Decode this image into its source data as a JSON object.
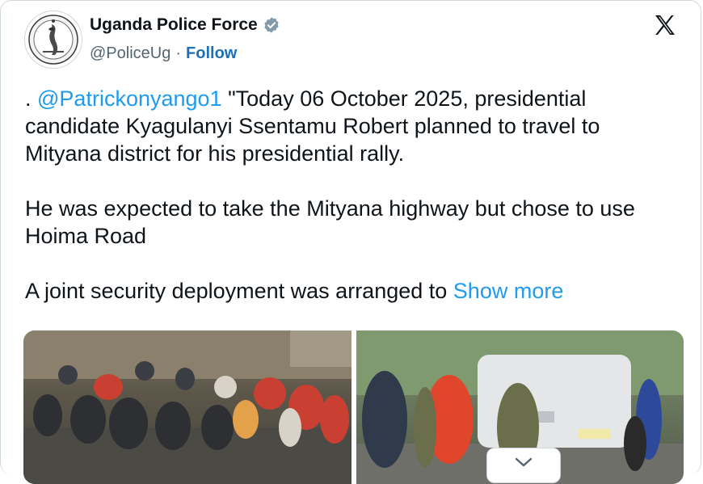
{
  "account": {
    "display_name": "Uganda Police Force",
    "handle": "@PoliceUg",
    "separator": "·",
    "follow_label": "Follow",
    "avatar_icon": "police-crest-icon",
    "verified_icon": "verified-badge-icon",
    "brand_icon": "x-logo-icon"
  },
  "tweet": {
    "prefix": ". ",
    "mention": "@Patrickonyango1",
    "paragraph1_rest": " \"Today 06 October 2025, presidential candidate Kyagulanyi Ssentamu Robert planned to travel to Mityana district for his presidential rally.",
    "paragraph2": "He was expected to take the Mityana highway but chose to use Hoima Road",
    "paragraph3": "A joint security deployment was arranged to ",
    "show_more": "Show more"
  },
  "media": {
    "count": 2,
    "expand_icon": "chevron-down-icon"
  },
  "colors": {
    "link": "#1d9bf0",
    "follow": "#1d70b8",
    "verified": "#829aab",
    "text": "#0f1419",
    "muted": "#536471"
  }
}
